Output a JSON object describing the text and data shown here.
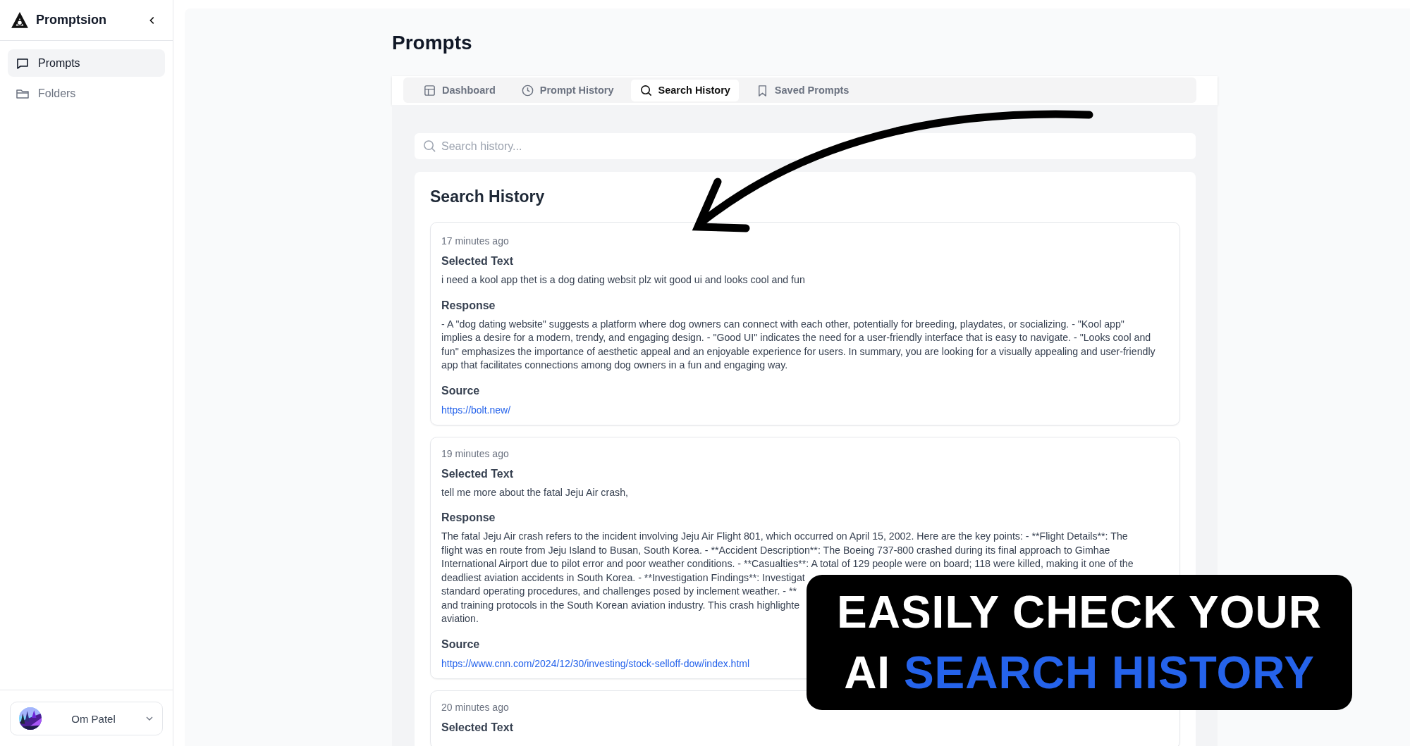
{
  "sidebar": {
    "brand": "Promptsion",
    "items": [
      {
        "label": "Prompts",
        "selected": true
      },
      {
        "label": "Folders",
        "selected": false
      }
    ],
    "user": {
      "name": "Om Patel"
    }
  },
  "page": {
    "title": "Prompts"
  },
  "tabs": [
    {
      "label": "Dashboard",
      "selected": false
    },
    {
      "label": "Prompt History",
      "selected": false
    },
    {
      "label": "Search History",
      "selected": true
    },
    {
      "label": "Saved Prompts",
      "selected": false
    }
  ],
  "search": {
    "placeholder": "Search history..."
  },
  "history": {
    "title": "Search History",
    "entries": [
      {
        "time": "17 minutes ago",
        "selected_label": "Selected Text",
        "selected_text": "i need a kool app thet is a dog dating websit plz wit good ui and looks cool and fun",
        "response_label": "Response",
        "response_lines": [
          "- A \"dog dating website\" suggests a platform where dog owners can connect with each other, potentially for breeding, playdates, or socializing. - \"Kool app\"",
          "implies a desire for a modern, trendy, and engaging design. - \"Good UI\" indicates the need for a user-friendly interface that is easy to navigate. - \"Looks cool and",
          "fun\" emphasizes the importance of aesthetic appeal and an enjoyable experience for users. In summary, you are looking for a visually appealing and user-friendly",
          "app that facilitates connections among dog owners in a fun and engaging way."
        ],
        "source_label": "Source",
        "source_url": "https://bolt.new/"
      },
      {
        "time": "19 minutes ago",
        "selected_label": "Selected Text",
        "selected_text": "tell me more about the fatal Jeju Air crash,",
        "response_label": "Response",
        "response_lines": [
          "The fatal Jeju Air crash refers to the incident involving Jeju Air Flight 801, which occurred on April 15, 2002. Here are the key points: - **Flight Details**: The",
          "flight was en route from Jeju Island to Busan, South Korea. - **Accident Description**: The Boeing 737-800 crashed during its final approach to Gimhae",
          "International Airport due to pilot error and poor weather conditions. - **Casualties**: A total of 129 people were on board; 118 were killed, making it one of the",
          "deadliest aviation accidents in South Korea. - **Investigation Findings**: Investigat",
          "standard operating procedures, and challenges posed by inclement weather. - **",
          "and training protocols in the South Korean aviation industry. This crash highlighte",
          "aviation."
        ],
        "source_label": "Source",
        "source_url": "https://www.cnn.com/2024/12/30/investing/stock-selloff-dow/index.html"
      },
      {
        "time": "20 minutes ago",
        "selected_label": "Selected Text"
      }
    ]
  },
  "overlay_banner": {
    "line_1": "EASILY CHECK YOUR",
    "line_2_start": "AI",
    "line_2_highlight": "SEARCH HISTORY"
  }
}
